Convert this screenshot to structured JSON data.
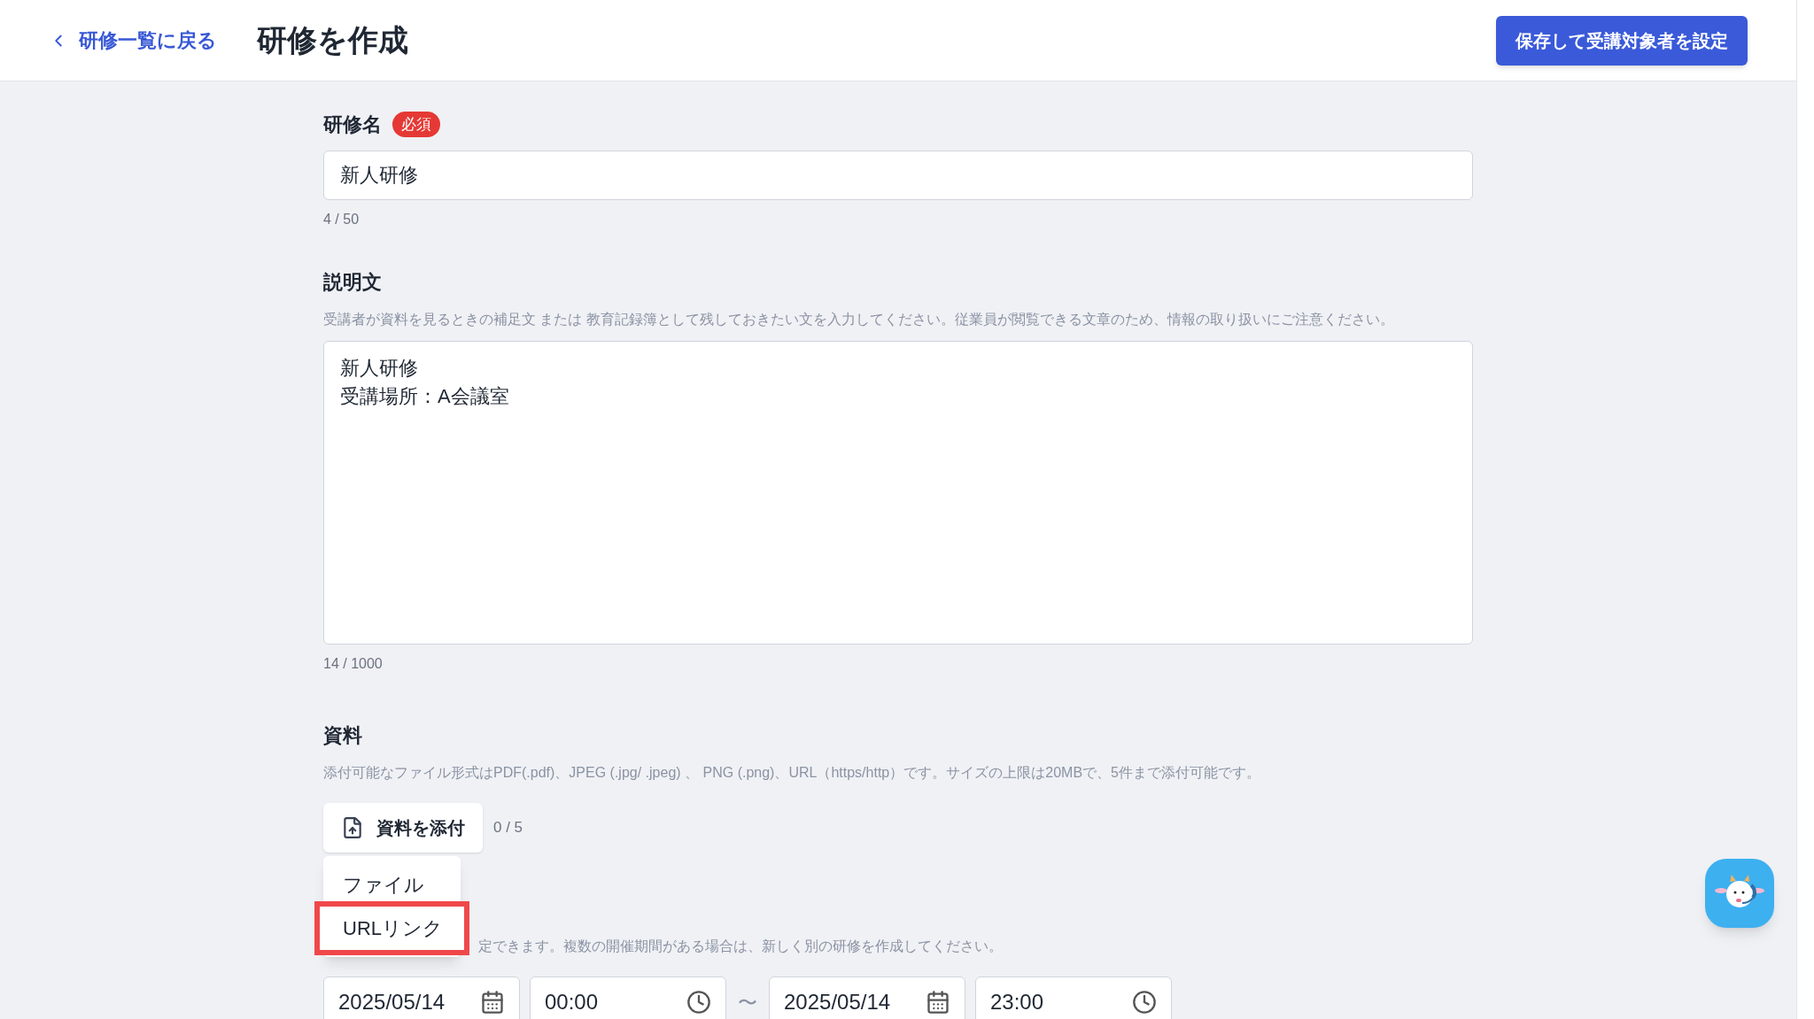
{
  "header": {
    "back_link": "研修一覧に戻る",
    "title": "研修を作成",
    "save_button": "保存して受講対象者を設定"
  },
  "name_field": {
    "label": "研修名",
    "required_badge": "必須",
    "value": "新人研修",
    "counter": "4 / 50"
  },
  "description_field": {
    "label": "説明文",
    "helper": "受講者が資料を見るときの補足文 または 教育記録簿として残しておきたい文を入力してください。従業員が閲覧できる文章のため、情報の取り扱いにご注意ください。",
    "lines": [
      "新人研修",
      "受講場所：A会議室"
    ],
    "counter": "14 / 1000"
  },
  "materials": {
    "label": "資料",
    "helper": "添付可能なファイル形式はPDF(.pdf)、JPEG (.jpg/ .jpeg) 、 PNG (.png)、URL（https/http）です。サイズの上限は20MBで、5件まで添付可能です。",
    "attach_button": "資料を添付",
    "count": "0 / 5",
    "menu": [
      {
        "label": "ファイル",
        "highlighted": false
      },
      {
        "label": "URLリンク",
        "highlighted": true
      }
    ]
  },
  "period": {
    "helper": "定できます。複数の開催期間がある場合は、新しく別の研修を作成してください。",
    "start_date": "2025/05/14",
    "start_time": "00:00",
    "separator": "〜",
    "end_date": "2025/05/14",
    "end_time": "23:00"
  }
}
